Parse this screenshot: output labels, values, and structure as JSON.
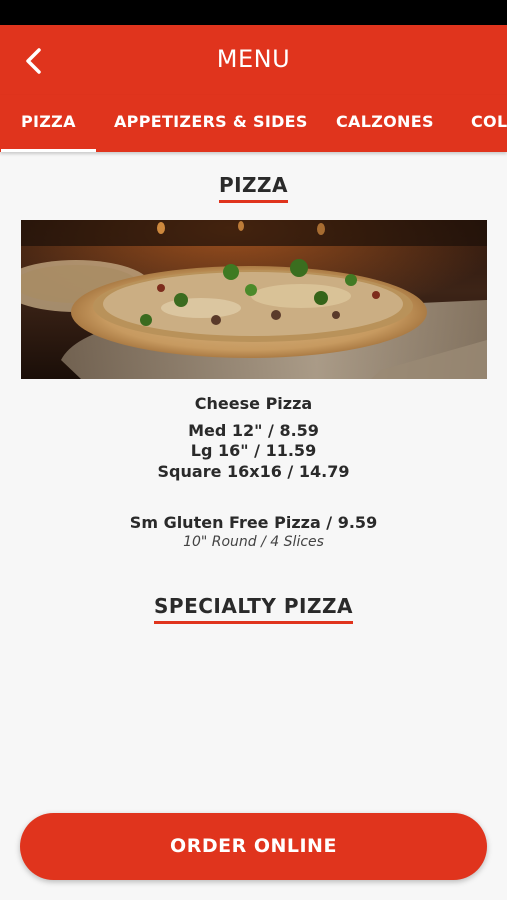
{
  "header": {
    "title": "MENU",
    "back_icon": "chevron-left-icon"
  },
  "tabs": [
    {
      "label": "PIZZA",
      "active": true
    },
    {
      "label": "APPETIZERS & SIDES",
      "active": false
    },
    {
      "label": "CALZONES",
      "active": false
    },
    {
      "label": "COL",
      "active": false
    }
  ],
  "sections": {
    "pizza": {
      "title": "PIZZA",
      "items": {
        "cheese": {
          "name": "Cheese Pizza",
          "sizes": [
            "Med 12\" / 8.59",
            "Lg 16\" / 11.59",
            "Square 16x16 / 14.79"
          ]
        },
        "gluten_free": {
          "name": "Sm Gluten Free Pizza / 9.59",
          "description": "10\" Round / 4 Slices"
        }
      }
    },
    "specialty": {
      "title": "SPECIALTY PIZZA"
    }
  },
  "order_button": {
    "label": "ORDER ONLINE"
  },
  "colors": {
    "brand_red": "#e0341d",
    "background": "#f7f7f7",
    "text": "#2a2a2a"
  }
}
